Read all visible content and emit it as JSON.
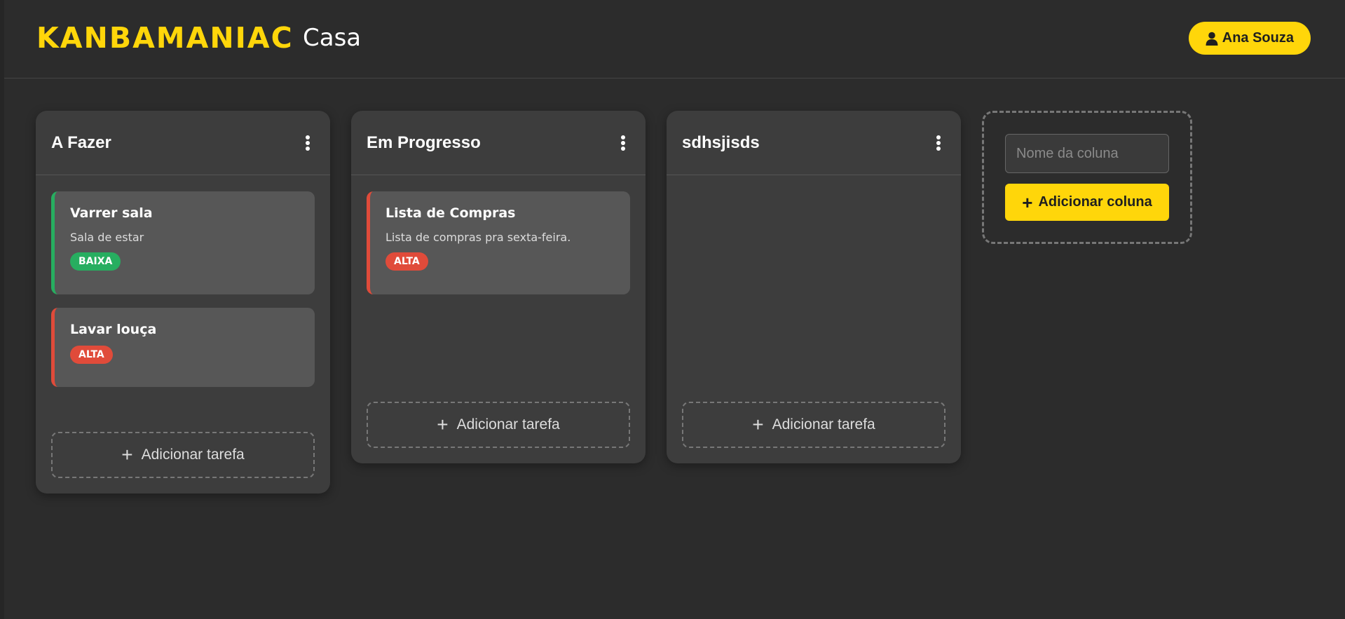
{
  "header": {
    "brand": "KANBAMANIAC",
    "board_title": "Casa",
    "user_name": "Ana Souza"
  },
  "columns": [
    {
      "title": "A Fazer",
      "cards": [
        {
          "title": "Varrer sala",
          "description": "Sala de estar",
          "priority": "BAIXA"
        },
        {
          "title": "Lavar louça",
          "description": "",
          "priority": "ALTA"
        }
      ],
      "add_task_label": "Adicionar tarefa"
    },
    {
      "title": "Em Progresso",
      "cards": [
        {
          "title": "Lista de Compras",
          "description": "Lista de compras pra sexta-feira.",
          "priority": "ALTA"
        }
      ],
      "add_task_label": "Adicionar tarefa"
    },
    {
      "title": "sdhsjisds",
      "cards": [],
      "add_task_label": "Adicionar tarefa"
    }
  ],
  "new_column": {
    "placeholder": "Nome da coluna",
    "button_label": "Adicionar coluna"
  },
  "colors": {
    "accent": "#ffd60a",
    "priority_low": "#27ae60",
    "priority_high": "#e04b3a",
    "background": "#2c2c2c",
    "column_bg": "#3d3d3d",
    "card_bg": "#575757"
  },
  "icons": {
    "user": "user-icon",
    "menu": "kebab-menu-icon",
    "add": "plus-icon"
  }
}
